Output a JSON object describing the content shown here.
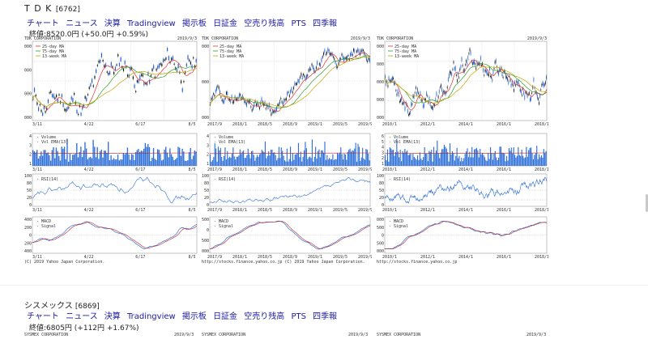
{
  "stocks": [
    {
      "name": "T D K",
      "code": "[6762]",
      "links": [
        "チャート",
        "ニュース",
        "決算",
        "Tradingview",
        "掲示板",
        "日証金",
        "空売り残高",
        "PTS",
        "四季報"
      ],
      "close_text": "終値:8520.0円 (+50.0円 +0.59%)",
      "panels": [
        {
          "company": "TDK CORPORATION",
          "date": "2019/9/3",
          "price_legend": [
            "25-day MA",
            "75-day MA",
            "13-week MA"
          ],
          "price_ticks": [
            "10000",
            "9000",
            "8000",
            "7000"
          ],
          "x_labels": [
            "3/11",
            "4/22",
            "6/17",
            "8/5"
          ],
          "volume_legend": [
            "Volume",
            "Vol EMA(13)"
          ],
          "volume_ticks": [
            "4",
            "3",
            "2",
            "1"
          ],
          "rsi_legend": "RSI(14)",
          "rsi_ticks": [
            "100",
            "80",
            "50",
            "20",
            "0"
          ],
          "macd_legend": [
            "MACD",
            "Signal"
          ],
          "macd_ticks": [
            "400",
            "200",
            "0",
            "-200",
            "-400"
          ],
          "footer": "(C) 2019 Yahoo Japan Corporation."
        },
        {
          "company": "TDK CORPORATION",
          "date": "2019/9/3",
          "price_legend": [
            "25-day MA",
            "75-day MA",
            "13-week MA"
          ],
          "price_ticks": [
            "12000",
            "10000",
            "8000"
          ],
          "x_labels": [
            "2017/9",
            "2018/1",
            "2018/5",
            "2018/9",
            "2019/1",
            "2019/5",
            "2019/9"
          ],
          "volume_legend": [
            "Volume",
            "Vol EMA(13)"
          ],
          "volume_ticks": [
            "4",
            "3",
            "2",
            "1"
          ],
          "rsi_legend": "RSI(14)",
          "rsi_ticks": [
            "100",
            "80",
            "50",
            "20",
            "0"
          ],
          "macd_legend": [
            "MACD",
            "Signal"
          ],
          "macd_ticks": [
            "500",
            "0",
            "-500",
            "-1000"
          ],
          "footer": "http://stocks.finance.yahoo.co.jp   (C) 2019 Yahoo Japan Corporation."
        },
        {
          "company": "TDK CORPORATION",
          "date": "2019/9/3",
          "price_legend": [
            "25-day MA",
            "75-day MA",
            "13-week MA"
          ],
          "price_ticks": [
            "10000",
            "8000",
            "6000",
            "4000",
            "2000"
          ],
          "x_labels": [
            "2010/1",
            "2012/1",
            "2014/1",
            "2016/1",
            "2018/1"
          ],
          "volume_legend": [
            "Volume",
            "Vol EMA(13)"
          ],
          "volume_ticks": [
            "6",
            "5",
            "4",
            "3",
            "2",
            "1"
          ],
          "rsi_legend": "RSI(14)",
          "rsi_ticks": [
            "100",
            "80",
            "50",
            "20",
            "0"
          ],
          "macd_legend": [
            "MACD",
            "Signal"
          ],
          "macd_ticks": [
            "1000",
            "500",
            "0",
            "-500",
            "-1000"
          ],
          "footer": "http://stocks.finance.yahoo.co.jp"
        }
      ]
    },
    {
      "name": "シスメックス",
      "code": "[6869]",
      "links": [
        "チャート",
        "ニュース",
        "決算",
        "Tradingview",
        "掲示板",
        "日証金",
        "空売り残高",
        "PTS",
        "四季報"
      ],
      "close_text": "終値:6805円 (+112円 +1.67%)",
      "panels": [
        {
          "company": "SYSMEX CORPORATION",
          "date": "2019/9/3"
        },
        {
          "company": "SYSMEX CORPORATION",
          "date": "2019/9/3"
        },
        {
          "company": "SYSMEX CORPORATION",
          "date": "2019/9/3"
        }
      ]
    }
  ],
  "colors": {
    "link": "#1a1aa6",
    "candle_up": "#1f5fd6",
    "candle_dn": "#111111",
    "ma25": "#e03030",
    "ma75": "#2aa02a",
    "ma13w": "#c9a300",
    "volume": "#2e6fd8",
    "rsi": "#2e6fd8",
    "macd": "#2e6fd8",
    "signal": "#c02020"
  }
}
